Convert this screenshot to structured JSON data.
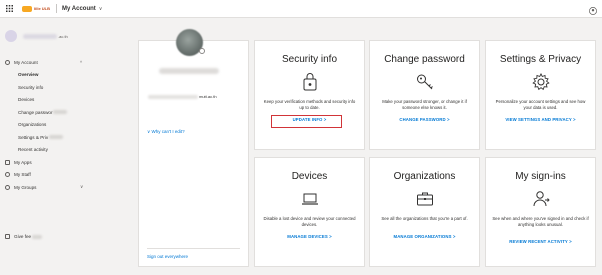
{
  "topbar": {
    "logo_text": "lille ULB",
    "app_title": "My Account",
    "title_chevron": "∨"
  },
  "user": {
    "email_suffix": ".ac.th"
  },
  "nav": {
    "my_account": "My Account",
    "overview": "Overview",
    "security_info": "Security info",
    "devices": "Devices",
    "change_password": "Change passwor",
    "organizations": "Organizations",
    "settings_privacy": "Settings & Priv",
    "recent_activity": "Recent activity",
    "my_apps": "My Apps",
    "my_staff": "My Staff",
    "my_groups": "My Groups",
    "give_feedback": "Give fee",
    "caret_up": "^",
    "caret_down": "∨"
  },
  "profile": {
    "email_suffix": "mutt.ac.th",
    "why_link": "∨  Why can't I edit?",
    "sign_out": "Sign out everywhere"
  },
  "cards": {
    "security": {
      "title": "Security info",
      "desc": "Keep your verification methods and security info up to date.",
      "link": "UPDATE INFO  >"
    },
    "password": {
      "title": "Change password",
      "desc": "Make your password stronger, or change it if someone else knows it.",
      "link": "CHANGE PASSWORD  >"
    },
    "settings": {
      "title": "Settings & Privacy",
      "desc": "Personalize your account settings and see how your data is used.",
      "link": "VIEW SETTINGS AND PRIVACY  >"
    },
    "devices": {
      "title": "Devices",
      "desc": "Disable a lost device and review your connected devices.",
      "link": "MANAGE DEVICES  >"
    },
    "organizations": {
      "title": "Organizations",
      "desc": "See all the organizations that you're a part of.",
      "link": "MANAGE ORGANIZATIONS  >"
    },
    "signins": {
      "title": "My sign-ins",
      "desc": "See when and where you've signed in and check if anything looks unusual.",
      "link": "REVIEW RECENT ACTIVITY  >"
    }
  },
  "colors": {
    "accent": "#0078d4",
    "highlight": "#d13438"
  }
}
